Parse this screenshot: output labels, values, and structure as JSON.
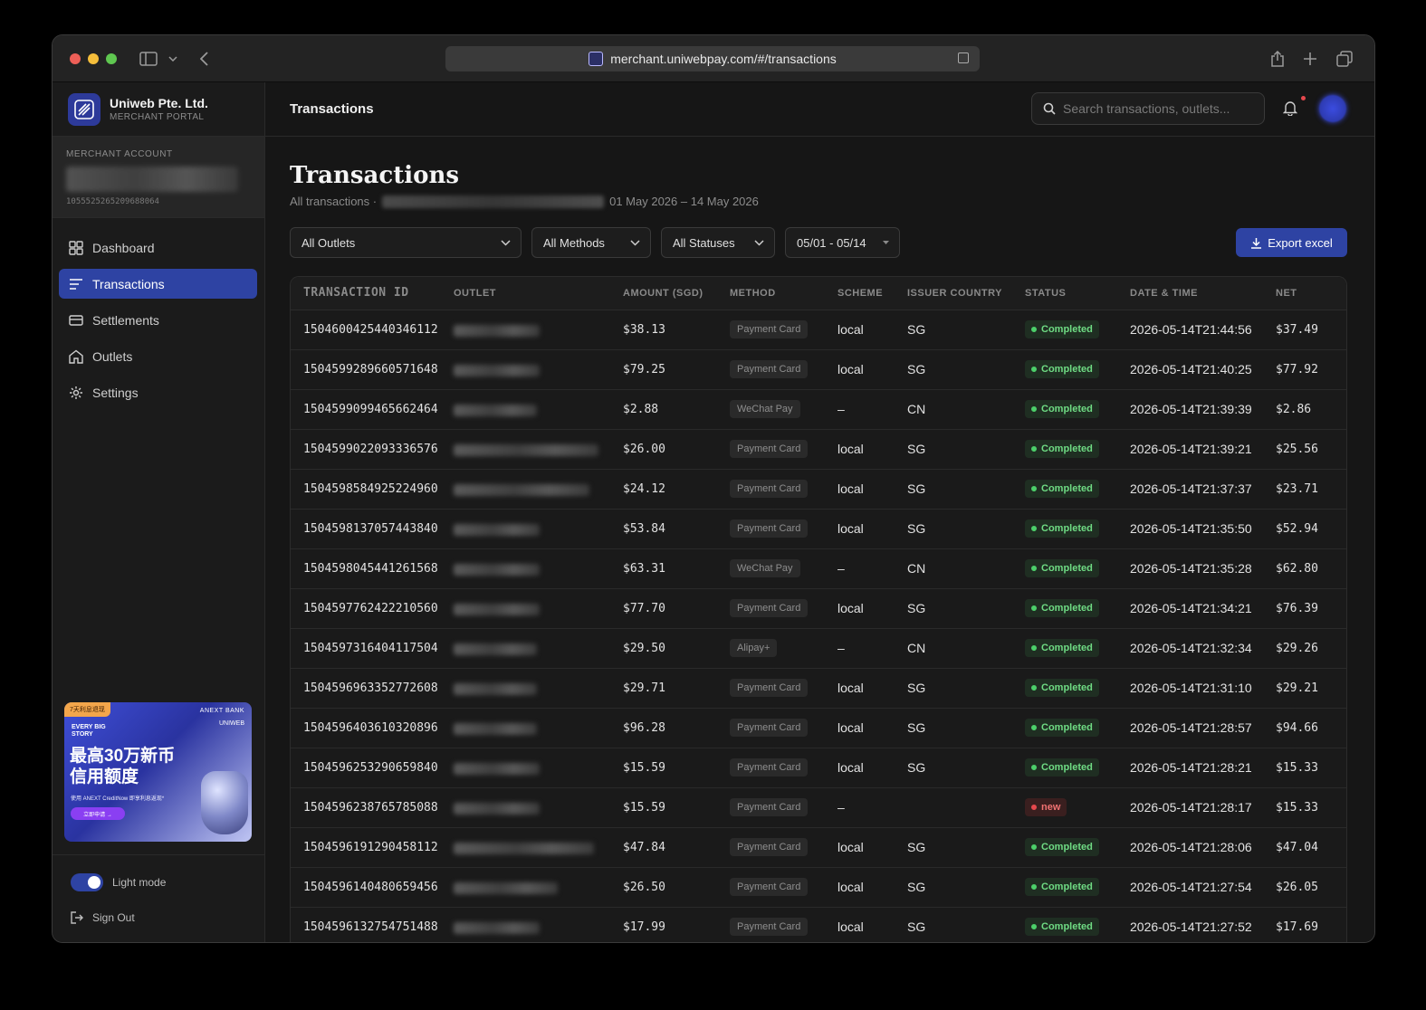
{
  "browser": {
    "url": "merchant.uniwebpay.com/#/transactions"
  },
  "sidebar": {
    "brand_name": "Uniweb Pte. Ltd.",
    "brand_sub": "MERCHANT PORTAL",
    "merchant_label": "MERCHANT ACCOUNT",
    "merchant_id": "1055525265209688064",
    "items": [
      {
        "label": "Dashboard",
        "icon": "dashboard-icon",
        "active": false
      },
      {
        "label": "Transactions",
        "icon": "list-icon",
        "active": true
      },
      {
        "label": "Settlements",
        "icon": "wallet-icon",
        "active": false
      },
      {
        "label": "Outlets",
        "icon": "home-icon",
        "active": false
      },
      {
        "label": "Settings",
        "icon": "gear-icon",
        "active": false
      }
    ],
    "promo": {
      "tag": "7天利息退现",
      "bank": "ANEXT BANK",
      "story": "EVERY BIG STORY",
      "brand": "UNIWEB",
      "headline_1": "最高30万新币",
      "headline_2": "信用额度",
      "line": "使用 ANEXT CreditNow 即享利息返现*",
      "button": "立即申请 →"
    },
    "toggle_label": "Light mode",
    "signout_label": "Sign Out"
  },
  "topbar": {
    "title": "Transactions",
    "search_placeholder": "Search transactions, outlets..."
  },
  "page": {
    "title": "Transactions",
    "subtitle_prefix": "All transactions ·",
    "date_range": "01 May 2026 – 14 May 2026"
  },
  "filters": {
    "outlets": "All Outlets",
    "methods": "All Methods",
    "statuses": "All Statuses",
    "dates": "05/01 - 05/14",
    "export": "Export excel"
  },
  "table": {
    "columns": [
      "TRANSACTION ID",
      "OUTLET",
      "AMOUNT (SGD)",
      "METHOD",
      "SCHEME",
      "ISSUER COUNTRY",
      "STATUS",
      "DATE & TIME",
      "NET"
    ],
    "rows": [
      {
        "id": "1504600425440346112",
        "amount": "$38.13",
        "method": "Payment Card",
        "scheme": "local",
        "country": "SG",
        "status": "Completed",
        "datetime": "2026-05-14T21:44:56",
        "net": "$37.49"
      },
      {
        "id": "1504599289660571648",
        "amount": "$79.25",
        "method": "Payment Card",
        "scheme": "local",
        "country": "SG",
        "status": "Completed",
        "datetime": "2026-05-14T21:40:25",
        "net": "$77.92"
      },
      {
        "id": "1504599099465662464",
        "amount": "$2.88",
        "method": "WeChat Pay",
        "scheme": "–",
        "country": "CN",
        "status": "Completed",
        "datetime": "2026-05-14T21:39:39",
        "net": "$2.86"
      },
      {
        "id": "1504599022093336576",
        "amount": "$26.00",
        "method": "Payment Card",
        "scheme": "local",
        "country": "SG",
        "status": "Completed",
        "datetime": "2026-05-14T21:39:21",
        "net": "$25.56"
      },
      {
        "id": "1504598584925224960",
        "amount": "$24.12",
        "method": "Payment Card",
        "scheme": "local",
        "country": "SG",
        "status": "Completed",
        "datetime": "2026-05-14T21:37:37",
        "net": "$23.71"
      },
      {
        "id": "1504598137057443840",
        "amount": "$53.84",
        "method": "Payment Card",
        "scheme": "local",
        "country": "SG",
        "status": "Completed",
        "datetime": "2026-05-14T21:35:50",
        "net": "$52.94"
      },
      {
        "id": "1504598045441261568",
        "amount": "$63.31",
        "method": "WeChat Pay",
        "scheme": "–",
        "country": "CN",
        "status": "Completed",
        "datetime": "2026-05-14T21:35:28",
        "net": "$62.80"
      },
      {
        "id": "1504597762422210560",
        "amount": "$77.70",
        "method": "Payment Card",
        "scheme": "local",
        "country": "SG",
        "status": "Completed",
        "datetime": "2026-05-14T21:34:21",
        "net": "$76.39"
      },
      {
        "id": "1504597316404117504",
        "amount": "$29.50",
        "method": "Alipay+",
        "scheme": "–",
        "country": "CN",
        "status": "Completed",
        "datetime": "2026-05-14T21:32:34",
        "net": "$29.26"
      },
      {
        "id": "1504596963352772608",
        "amount": "$29.71",
        "method": "Payment Card",
        "scheme": "local",
        "country": "SG",
        "status": "Completed",
        "datetime": "2026-05-14T21:31:10",
        "net": "$29.21"
      },
      {
        "id": "1504596403610320896",
        "amount": "$96.28",
        "method": "Payment Card",
        "scheme": "local",
        "country": "SG",
        "status": "Completed",
        "datetime": "2026-05-14T21:28:57",
        "net": "$94.66"
      },
      {
        "id": "1504596253290659840",
        "amount": "$15.59",
        "method": "Payment Card",
        "scheme": "local",
        "country": "SG",
        "status": "Completed",
        "datetime": "2026-05-14T21:28:21",
        "net": "$15.33"
      },
      {
        "id": "1504596238765785088",
        "amount": "$15.59",
        "method": "Payment Card",
        "scheme": "–",
        "country": "",
        "status": "new",
        "datetime": "2026-05-14T21:28:17",
        "net": "$15.33"
      },
      {
        "id": "1504596191290458112",
        "amount": "$47.84",
        "method": "Payment Card",
        "scheme": "local",
        "country": "SG",
        "status": "Completed",
        "datetime": "2026-05-14T21:28:06",
        "net": "$47.04"
      },
      {
        "id": "1504596140480659456",
        "amount": "$26.50",
        "method": "Payment Card",
        "scheme": "local",
        "country": "SG",
        "status": "Completed",
        "datetime": "2026-05-14T21:27:54",
        "net": "$26.05"
      },
      {
        "id": "1504596132754751488",
        "amount": "$17.99",
        "method": "Payment Card",
        "scheme": "local",
        "country": "SG",
        "status": "Completed",
        "datetime": "2026-05-14T21:27:52",
        "net": "$17.69"
      }
    ]
  },
  "colors": {
    "accent": "#2e43a3",
    "completed": "#6fdc84",
    "new": "#f07272"
  }
}
